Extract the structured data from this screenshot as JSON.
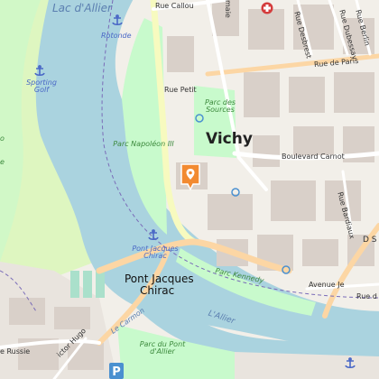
{
  "map": {
    "city_label": "Vichy",
    "lake_label": "Lac d'Allier",
    "river_label_east": "L'Allier",
    "river_label_west": "L'Allier",
    "bridge_label_line1": "Pont Jacques",
    "bridge_label_line2": "Chirac",
    "streets": [
      "Rue Callou",
      "Rue Petit",
      "Rue de Paris",
      "Rue Desbrest",
      "Rue Dubessay",
      "Rue Berlin",
      "Boulevard Carnot",
      "Rue Bardiaux",
      "Avenue Je",
      "D S",
      "Rue d",
      "ictor Hugo",
      "e Russie",
      "Le Carmon",
      "maie"
    ],
    "parks": [
      "Parc des Sources",
      "Parc Napoléon III",
      "Parc Kennedy",
      "Parc du Pont d'Allier",
      "o",
      "e"
    ],
    "marinas": [
      "Rotonde",
      "Sporting Golf",
      "Pont Jacques Chirac"
    ],
    "markers": {
      "selected_pin": "location-pin-icon",
      "hospital": "hospital-icon",
      "parking": "P"
    },
    "colors": {
      "water": "#aad3df",
      "park": "#c8facc",
      "golf": "#def6c0",
      "building": "#d9d0c9",
      "primary_road": "#fcd6a4",
      "secondary_road": "#f7fabf",
      "pin": "#f28a31",
      "marina": "#4a68c6"
    }
  }
}
